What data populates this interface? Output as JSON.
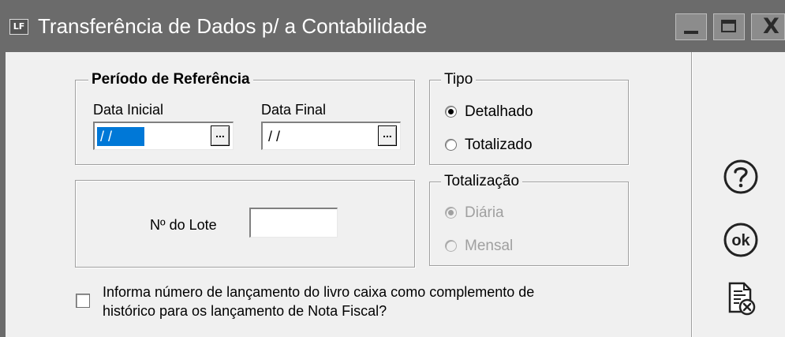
{
  "window": {
    "app_icon_text": "LF",
    "title": "Transferência de Dados p/ a Contabilidade",
    "close_glyph": "X"
  },
  "periodo": {
    "legend": "Período de Referência",
    "data_inicial_label": "Data Inicial",
    "data_inicial_value": "/ /",
    "data_final_label": "Data Final",
    "data_final_value": "/ /",
    "picker_glyph": "..."
  },
  "tipo": {
    "legend": "Tipo",
    "options": [
      {
        "label": "Detalhado",
        "checked": true,
        "disabled": false
      },
      {
        "label": "Totalizado",
        "checked": false,
        "disabled": false
      }
    ]
  },
  "lote": {
    "label": "Nº do Lote",
    "value": ""
  },
  "totalizacao": {
    "legend": "Totalização",
    "options": [
      {
        "label": "Diária",
        "checked": true,
        "disabled": true
      },
      {
        "label": "Mensal",
        "checked": false,
        "disabled": true
      }
    ]
  },
  "livro_caixa": {
    "checked": false,
    "text_line1": "Informa número de lançamento do livro caixa como complemento de",
    "text_line2": "histórico para os lançamento de Nota Fiscal?"
  },
  "sidebar": {
    "help_icon": "help-circle-icon",
    "ok_icon": "ok-circle-icon",
    "ok_text": "ok",
    "cancel_icon": "document-cancel-icon"
  }
}
